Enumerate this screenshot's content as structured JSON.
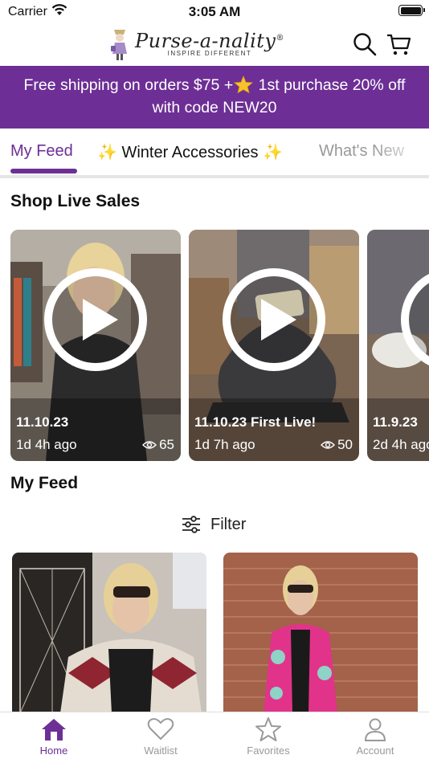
{
  "status_bar": {
    "carrier": "Carrier",
    "time": "3:05 AM"
  },
  "header": {
    "brand": "Purse-a-nality",
    "brand_mark": "®",
    "tagline": "INSPIRE DIFFERENT",
    "icons": [
      "search-icon",
      "cart-icon"
    ]
  },
  "promo": {
    "line1_before": "Free shipping on orders $75 +",
    "line1_after": " 1st purchase 20% off",
    "line2": "with code NEW20",
    "background": "#6d2f95"
  },
  "tabs": [
    {
      "label": "My Feed",
      "active": true
    },
    {
      "label": "✨ Winter  Accessories ✨",
      "active": false
    },
    {
      "label": "What's New",
      "active": false
    }
  ],
  "live_section": {
    "title": "Shop Live Sales",
    "cards": [
      {
        "title": "11.10.23",
        "ago": "1d 4h ago",
        "views": "65"
      },
      {
        "title": "11.10.23 First Live!",
        "ago": "1d 7h ago",
        "views": "50"
      },
      {
        "title": "11.9.23",
        "ago": "2d 4h ago",
        "views": ""
      }
    ]
  },
  "feed_section": {
    "title": "My Feed",
    "filter_label": "Filter"
  },
  "bottom_nav": [
    {
      "label": "Home",
      "icon": "home-icon",
      "active": true
    },
    {
      "label": "Waitlist",
      "icon": "heart-icon",
      "active": false
    },
    {
      "label": "Favorites",
      "icon": "star-icon",
      "active": false
    },
    {
      "label": "Account",
      "icon": "person-icon",
      "active": false
    }
  ],
  "colors": {
    "accent": "#6d2f95",
    "inactive_nav": "#999999"
  }
}
